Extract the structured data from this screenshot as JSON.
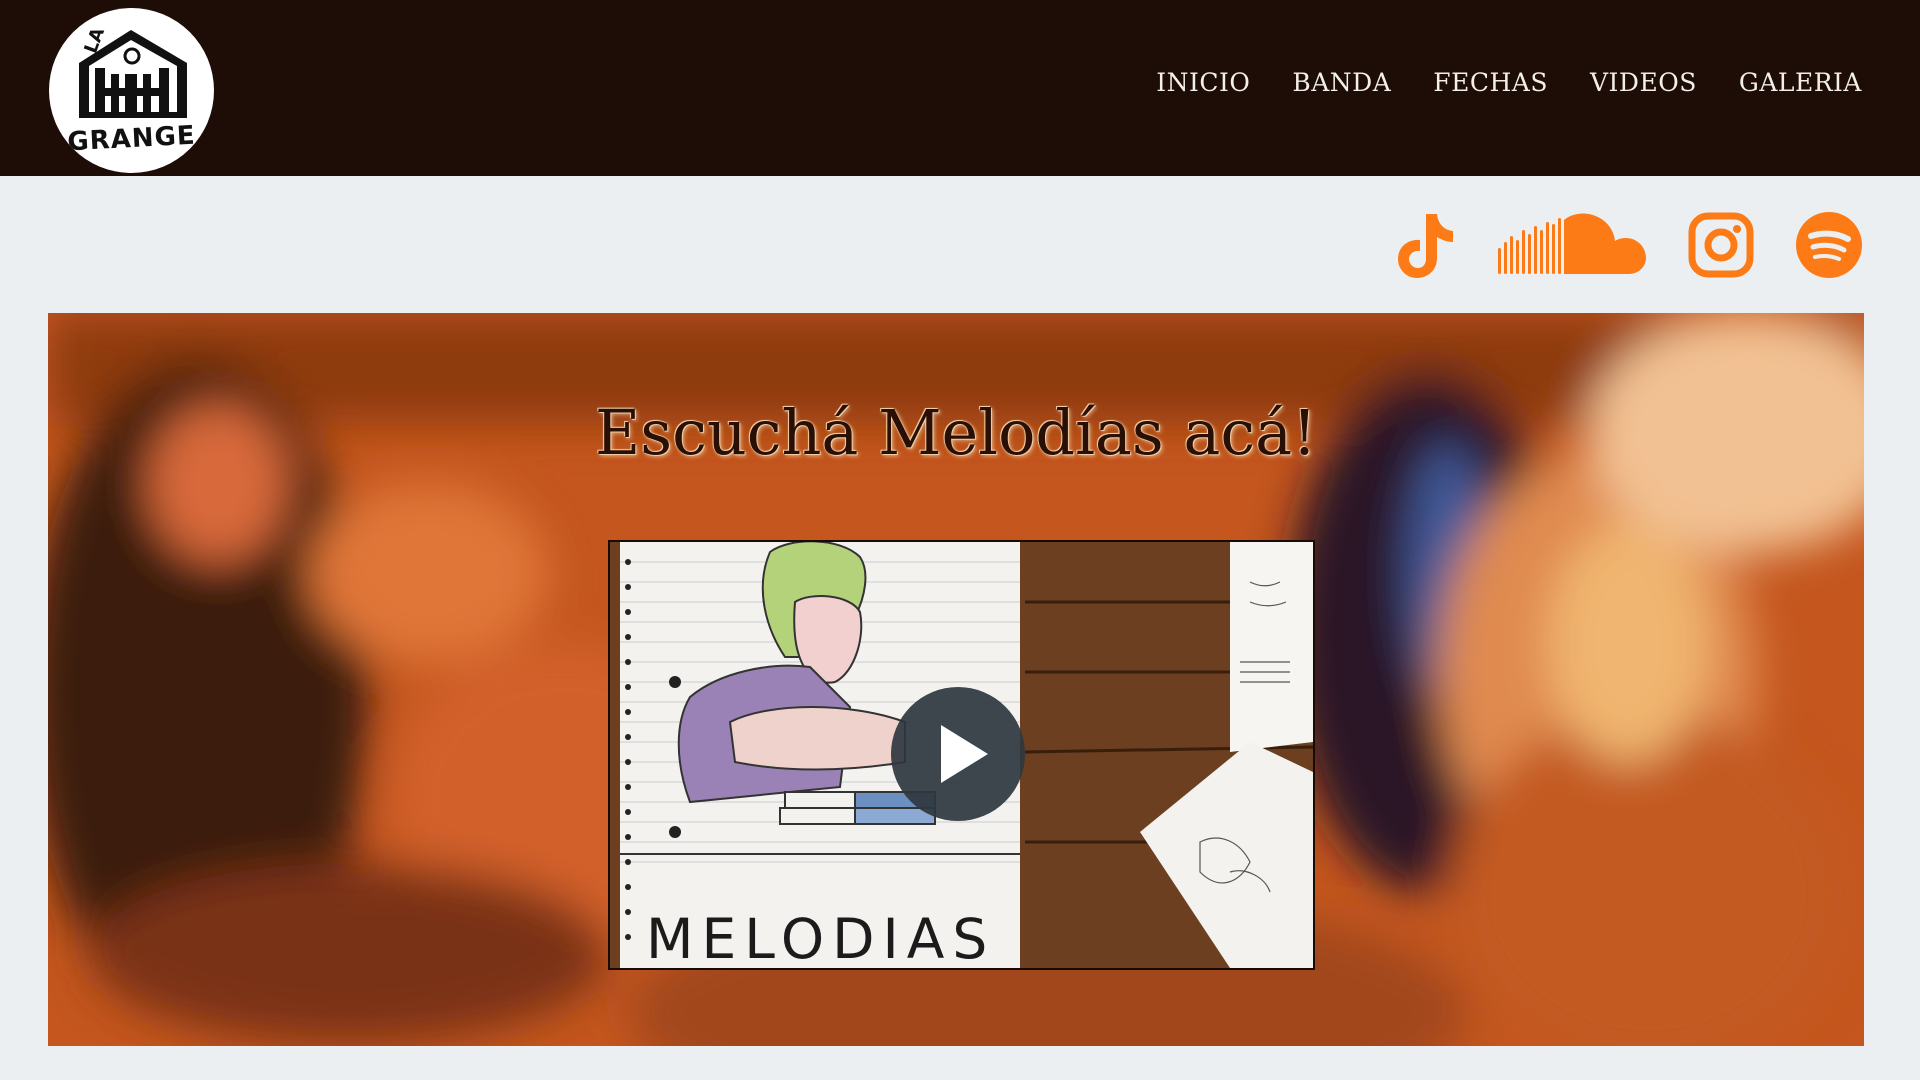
{
  "logo": {
    "text_top": "LA",
    "text_bottom": "GRANGE"
  },
  "nav": {
    "items": [
      {
        "label": "INICIO"
      },
      {
        "label": "BANDA"
      },
      {
        "label": "FECHAS"
      },
      {
        "label": "VIDEOS"
      },
      {
        "label": "GALERIA"
      }
    ]
  },
  "social": {
    "icons": [
      "tiktok-icon",
      "soundcloud-icon",
      "instagram-icon",
      "spotify-icon"
    ],
    "color": "#fd7b17"
  },
  "hero": {
    "title": "Escuchá Melodías acá!",
    "video": {
      "thumbnail_text": "MELODIAS",
      "play_icon": "play-icon"
    }
  },
  "colors": {
    "header_bg": "#1e0c06",
    "page_bg": "#eceff1",
    "hero_tint": "#c2531b",
    "accent": "#fd7b17"
  }
}
